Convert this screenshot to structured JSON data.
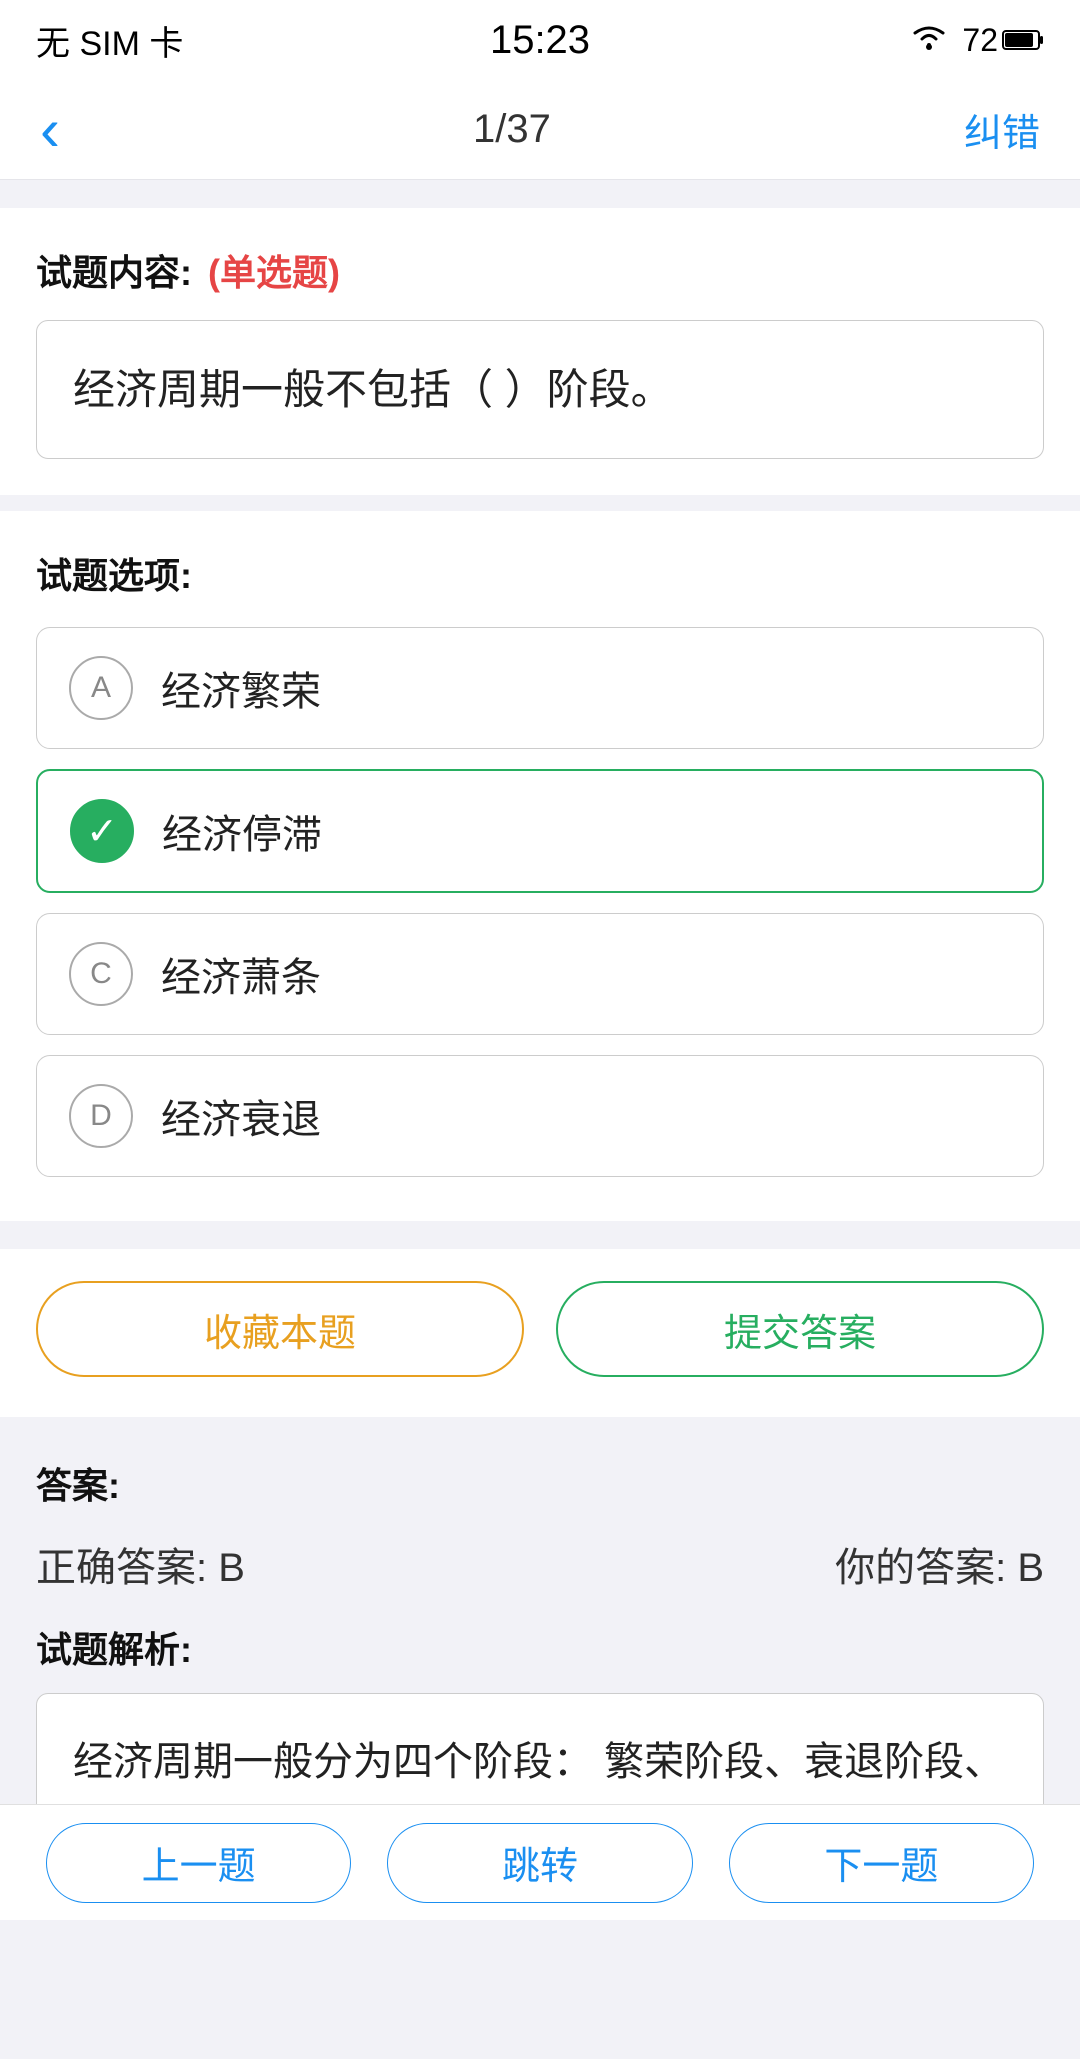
{
  "statusBar": {
    "noSim": "无 SIM 卡",
    "time": "15:23",
    "batteryLevel": "72"
  },
  "navBar": {
    "backIcon": "‹",
    "title": "1/37",
    "actionLabel": "纠错"
  },
  "question": {
    "sectionLabel": "试题内容:",
    "typeTag": "(单选题)",
    "text": "经济周期一般不包括（    ）阶段。"
  },
  "optionsLabel": "试题选项:",
  "options": [
    {
      "id": "A",
      "text": "经济繁荣",
      "selected": false,
      "correct": false
    },
    {
      "id": "B",
      "text": "经济停滞",
      "selected": true,
      "correct": true
    },
    {
      "id": "C",
      "text": "经济萧条",
      "selected": false,
      "correct": false
    },
    {
      "id": "D",
      "text": "经济衰退",
      "selected": false,
      "correct": false
    }
  ],
  "buttons": {
    "collect": "收藏本题",
    "submit": "提交答案"
  },
  "answerSection": {
    "label": "答案:",
    "correctAnswer": "正确答案: B",
    "yourAnswer": "你的答案: B"
  },
  "analysisSection": {
    "label": "试题解析:",
    "text": "经济周期一般分为四个阶段： 繁荣阶段、衰退阶段、萧条阶段和复苏阶段。"
  },
  "bottomNav": {
    "prev": "上一题",
    "jump": "跳转",
    "next": "下一题"
  }
}
